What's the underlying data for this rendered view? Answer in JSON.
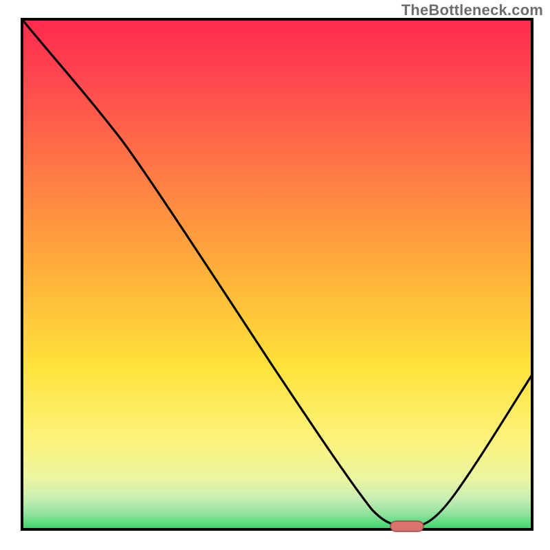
{
  "watermark": "TheBottleneck.com",
  "colors": {
    "border": "#000000",
    "band_red": "#ff2b4d",
    "band_orange": "#ff8a3a",
    "band_yellow": "#ffe23a",
    "band_cream": "#fbf6a8",
    "band_ltgreen": "#b6e79a",
    "band_green": "#36d66a",
    "curve": "#000000",
    "marker_fill": "#d9746c",
    "marker_stroke": "#9c4b44"
  },
  "chart_data": {
    "type": "line",
    "title": "",
    "xlabel": "",
    "ylabel": "",
    "xlim": [
      0,
      100
    ],
    "ylim": [
      0,
      100
    ],
    "note": "No numeric axis ticks are rendered in the image; values below are read off relative to the plotting area (0–100 on each axis).",
    "curve": [
      {
        "x": 0,
        "y": 100
      },
      {
        "x": 9,
        "y": 92
      },
      {
        "x": 18,
        "y": 82
      },
      {
        "x": 24,
        "y": 74
      },
      {
        "x": 35,
        "y": 57
      },
      {
        "x": 46,
        "y": 40
      },
      {
        "x": 56,
        "y": 23
      },
      {
        "x": 63,
        "y": 11
      },
      {
        "x": 68,
        "y": 4
      },
      {
        "x": 72,
        "y": 1
      },
      {
        "x": 77,
        "y": 1
      },
      {
        "x": 82,
        "y": 6
      },
      {
        "x": 90,
        "y": 22
      },
      {
        "x": 100,
        "y": 42
      }
    ],
    "optimal_marker": {
      "x_start": 72,
      "x_end": 78,
      "y": 1
    },
    "legend": [],
    "grid": false
  }
}
